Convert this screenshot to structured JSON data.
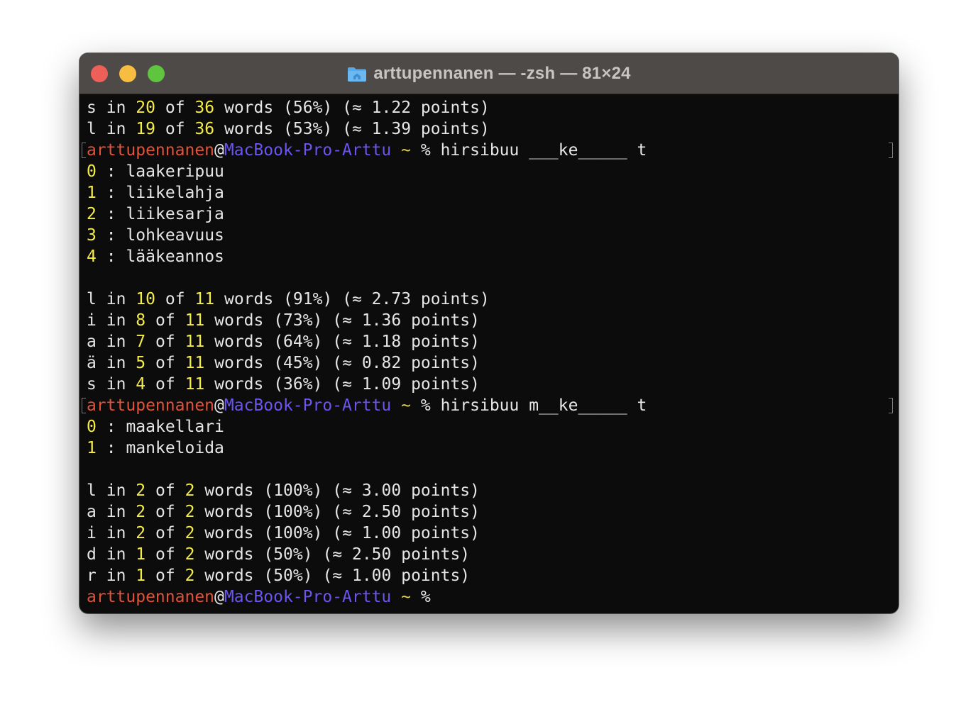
{
  "window": {
    "title": "arttupennanen — -zsh — 81×24",
    "icon": "folder-home-icon",
    "colors": {
      "background": "#0c0c0c",
      "titlebar": "#4d4a48",
      "number": "#f4ec49",
      "user": "#e0533a",
      "host": "#6a55f0",
      "text": "#e6e6e6"
    }
  },
  "prompt": {
    "user": "arttupennanen",
    "at": "@",
    "host": "MacBook-Pro-Arttu",
    "tilde": "~",
    "symbol": "%"
  },
  "terminal": {
    "block1_stats": [
      {
        "letter": "s",
        "count": "20",
        "total": "36",
        "rest": "words (56%) (≈ 1.22 points)"
      },
      {
        "letter": "l",
        "count": "19",
        "total": "36",
        "rest": "words (53%) (≈ 1.39 points)"
      }
    ],
    "command1": "hirsibuu ___ke_____ t",
    "list1": [
      {
        "index": "0",
        "word": "laakeripuu"
      },
      {
        "index": "1",
        "word": "liikelahja"
      },
      {
        "index": "2",
        "word": "liikesarja"
      },
      {
        "index": "3",
        "word": "lohkeavuus"
      },
      {
        "index": "4",
        "word": "lääkeannos"
      }
    ],
    "block2_stats": [
      {
        "letter": "l",
        "count": "10",
        "total": "11",
        "rest": "words (91%) (≈ 2.73 points)"
      },
      {
        "letter": "i",
        "count": "8",
        "total": "11",
        "rest": "words (73%) (≈ 1.36 points)"
      },
      {
        "letter": "a",
        "count": "7",
        "total": "11",
        "rest": "words (64%) (≈ 1.18 points)"
      },
      {
        "letter": "ä",
        "count": "5",
        "total": "11",
        "rest": "words (45%) (≈ 0.82 points)"
      },
      {
        "letter": "s",
        "count": "4",
        "total": "11",
        "rest": "words (36%) (≈ 1.09 points)"
      }
    ],
    "command2": "hirsibuu m__ke_____ t",
    "list2": [
      {
        "index": "0",
        "word": "maakellari"
      },
      {
        "index": "1",
        "word": "mankeloida"
      }
    ],
    "block3_stats": [
      {
        "letter": "l",
        "count": "2",
        "total": "2",
        "rest": "words (100%) (≈ 3.00 points)"
      },
      {
        "letter": "a",
        "count": "2",
        "total": "2",
        "rest": "words (100%) (≈ 2.50 points)"
      },
      {
        "letter": "i",
        "count": "2",
        "total": "2",
        "rest": "words (100%) (≈ 1.00 points)"
      },
      {
        "letter": "d",
        "count": "1",
        "total": "2",
        "rest": "words (50%) (≈ 2.50 points)"
      },
      {
        "letter": "r",
        "count": "1",
        "total": "2",
        "rest": "words (50%) (≈ 1.00 points)"
      }
    ],
    "in_word": "in",
    "of_word": "of",
    "separator": ":"
  }
}
